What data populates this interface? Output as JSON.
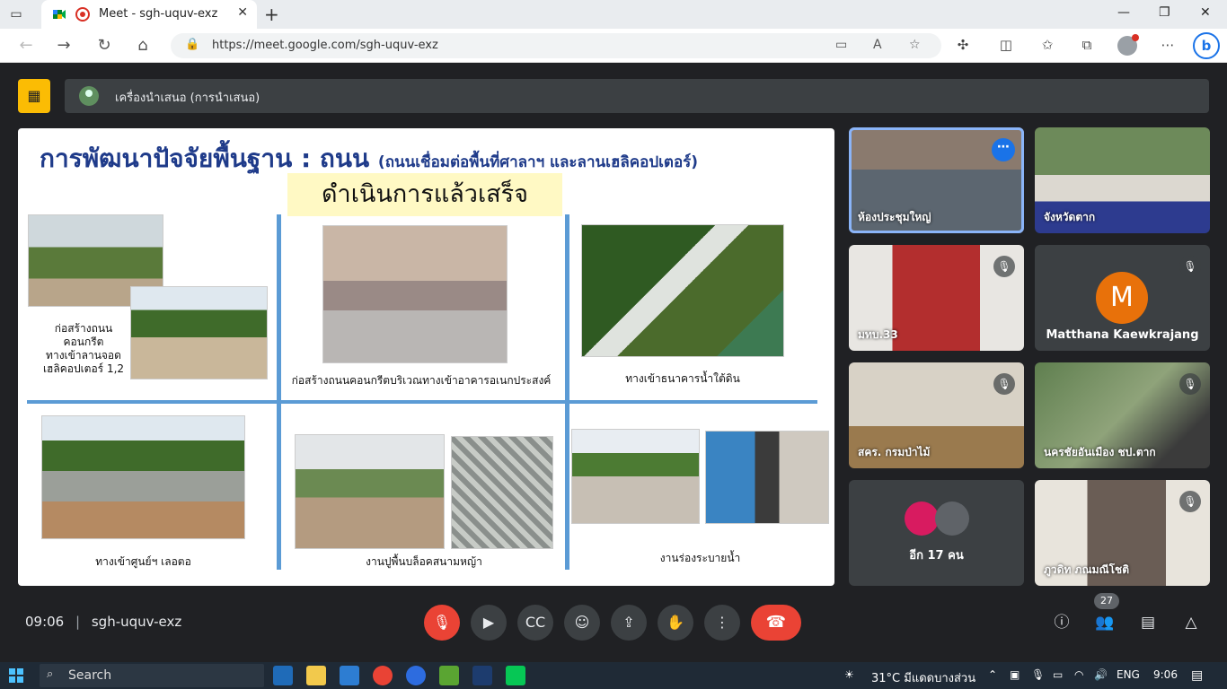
{
  "browser": {
    "tab_title": "Meet - sgh-uquv-exz",
    "url": "https://meet.google.com/sgh-uquv-exz",
    "new_tab": "+",
    "bing": "b"
  },
  "meet": {
    "presenter_label": "เครื่องนำเสนอ (การนำเสนอ)",
    "meeting_time": "09:06",
    "meeting_code": "sgh-uquv-exz",
    "participants_count": "27"
  },
  "slide": {
    "title": "การพัฒนาปัจจัยพื้นฐาน : ถนน",
    "title_sub": "(ถนนเชื่อมต่อพื้นที่ศาลาฯ และลานเฮลิคอปเตอร์)",
    "status": "ดำเนินการแล้วเสร็จ",
    "captions": {
      "c1": "ก่อสร้างถนน\nคอนกรีต\nทางเข้าลานจอด\nเฮลิคอปเตอร์ 1,2",
      "c2": "ก่อสร้างถนนคอนกรีตบริเวณทางเข้าอาคารอเนกประสงค์",
      "c3": "ทางเข้าธนาคารน้ำใต้ดิน",
      "c4": "ทางเข้าศูนย์ฯ เลอตอ",
      "c5": "งานปูพื้นบล็อคสนามหญ้า",
      "c6": "งานร่องระบายน้ำ"
    }
  },
  "tiles": [
    {
      "name": "ห้องประชุมใหญ่"
    },
    {
      "name": "จังหวัดตาก"
    },
    {
      "name": "มทบ.33"
    },
    {
      "name": "Matthana Kaewkrajang",
      "initial": "M"
    },
    {
      "name": "สคร. กรมป่าไม้"
    },
    {
      "name": "นครชัยอันเมือง ชป.ตาก"
    },
    {
      "name": "อีก 17 คน"
    },
    {
      "name": "ภูวดิท ภณมณีโชติ"
    }
  ],
  "taskbar": {
    "search_label": "Search",
    "weather": "31°C  มีแดดบางส่วน",
    "lang": "ENG",
    "clock": "9:06"
  },
  "colors": {
    "meet_bg": "#202124",
    "presenting_yellow": "#fbbc04",
    "end_call_red": "#ea4335",
    "active_tile_outline": "#8ab4f8",
    "slide_title_blue": "#1f3b8a"
  }
}
